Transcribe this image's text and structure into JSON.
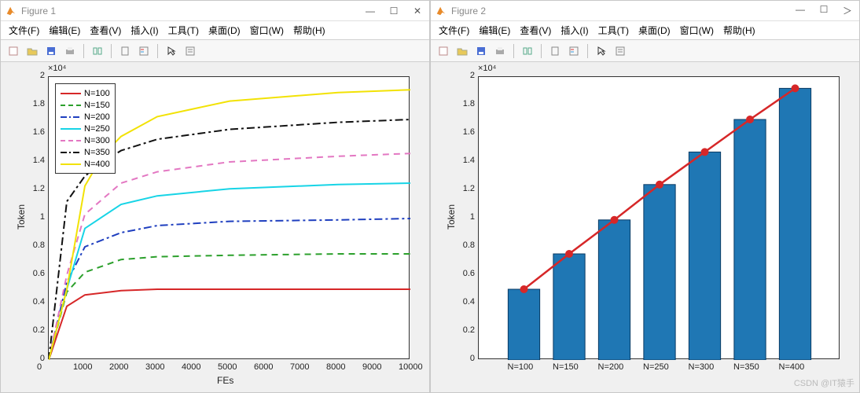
{
  "figure1": {
    "title": "Figure 1",
    "menu": [
      "文件(F)",
      "编辑(E)",
      "查看(V)",
      "插入(I)",
      "工具(T)",
      "桌面(D)",
      "窗口(W)",
      "帮助(H)"
    ],
    "winbtns": [
      "—",
      "☐",
      "✕"
    ]
  },
  "figure2": {
    "title": "Figure 2",
    "menu": [
      "文件(F)",
      "编辑(E)",
      "查看(V)",
      "插入(I)",
      "工具(T)",
      "桌面(D)",
      "窗口(W)",
      "帮助(H)"
    ],
    "winbtns": [
      "—",
      "☐",
      "＞"
    ]
  },
  "watermark": "CSDN @IT猿手",
  "chart_data": [
    {
      "type": "line",
      "title": "",
      "xlabel": "FEs",
      "ylabel": "Token",
      "exponent": "×10⁴",
      "xlim": [
        0,
        10000
      ],
      "ylim": [
        0,
        2.0
      ],
      "xticks": [
        0,
        1000,
        2000,
        3000,
        4000,
        5000,
        6000,
        7000,
        8000,
        9000,
        10000
      ],
      "yticks": [
        0,
        0.2,
        0.4,
        0.6,
        0.8,
        1.0,
        1.2,
        1.4,
        1.6,
        1.8,
        2.0
      ],
      "series": [
        {
          "name": "N=100",
          "color": "#d62728",
          "style": "solid",
          "x": [
            0,
            500,
            1000,
            2000,
            3000,
            5000,
            8000,
            10000
          ],
          "y": [
            0,
            0.38,
            0.46,
            0.49,
            0.5,
            0.5,
            0.5,
            0.5
          ]
        },
        {
          "name": "N=150",
          "color": "#2ca02c",
          "style": "dashed",
          "x": [
            0,
            500,
            1000,
            2000,
            3000,
            5000,
            8000,
            10000
          ],
          "y": [
            0,
            0.48,
            0.62,
            0.71,
            0.73,
            0.74,
            0.75,
            0.75
          ]
        },
        {
          "name": "N=200",
          "color": "#1f3fbf",
          "style": "dashdot",
          "x": [
            0,
            500,
            1000,
            2000,
            3000,
            5000,
            8000,
            10000
          ],
          "y": [
            0,
            0.55,
            0.8,
            0.9,
            0.95,
            0.98,
            0.99,
            1.0
          ]
        },
        {
          "name": "N=250",
          "color": "#17d4e6",
          "style": "solid",
          "x": [
            0,
            500,
            1000,
            2000,
            3000,
            5000,
            8000,
            10000
          ],
          "y": [
            0,
            0.5,
            0.93,
            1.1,
            1.16,
            1.21,
            1.24,
            1.25
          ]
        },
        {
          "name": "N=300",
          "color": "#e377c2",
          "style": "dashed",
          "x": [
            0,
            500,
            1000,
            2000,
            3000,
            5000,
            8000,
            10000
          ],
          "y": [
            0,
            0.6,
            1.03,
            1.25,
            1.33,
            1.4,
            1.44,
            1.46
          ]
        },
        {
          "name": "N=350",
          "color": "#111111",
          "style": "dashdot",
          "x": [
            0,
            500,
            1000,
            1500,
            2000,
            3000,
            5000,
            8000,
            10000
          ],
          "y": [
            0,
            1.12,
            1.3,
            1.4,
            1.48,
            1.56,
            1.63,
            1.68,
            1.7
          ]
        },
        {
          "name": "N=400",
          "color": "#f2e205",
          "style": "solid",
          "x": [
            0,
            500,
            1000,
            1500,
            2000,
            3000,
            5000,
            8000,
            10000
          ],
          "y": [
            0,
            0.5,
            1.23,
            1.45,
            1.58,
            1.72,
            1.83,
            1.89,
            1.91
          ]
        }
      ]
    },
    {
      "type": "bar",
      "title": "",
      "xlabel": "",
      "ylabel": "Token",
      "exponent": "×10⁴",
      "ylim": [
        0,
        2.0
      ],
      "yticks": [
        0,
        0.2,
        0.4,
        0.6,
        0.8,
        1.0,
        1.2,
        1.4,
        1.6,
        1.8,
        2.0
      ],
      "categories": [
        "N=100",
        "N=150",
        "N=200",
        "N=250",
        "N=300",
        "N=350",
        "N=400"
      ],
      "values": [
        0.5,
        0.75,
        0.99,
        1.24,
        1.47,
        1.7,
        1.92
      ],
      "bar_color": "#1f77b4",
      "overlay_line": {
        "color": "#d62728",
        "markers": true,
        "values": [
          0.5,
          0.75,
          0.99,
          1.24,
          1.47,
          1.7,
          1.92
        ]
      }
    }
  ]
}
